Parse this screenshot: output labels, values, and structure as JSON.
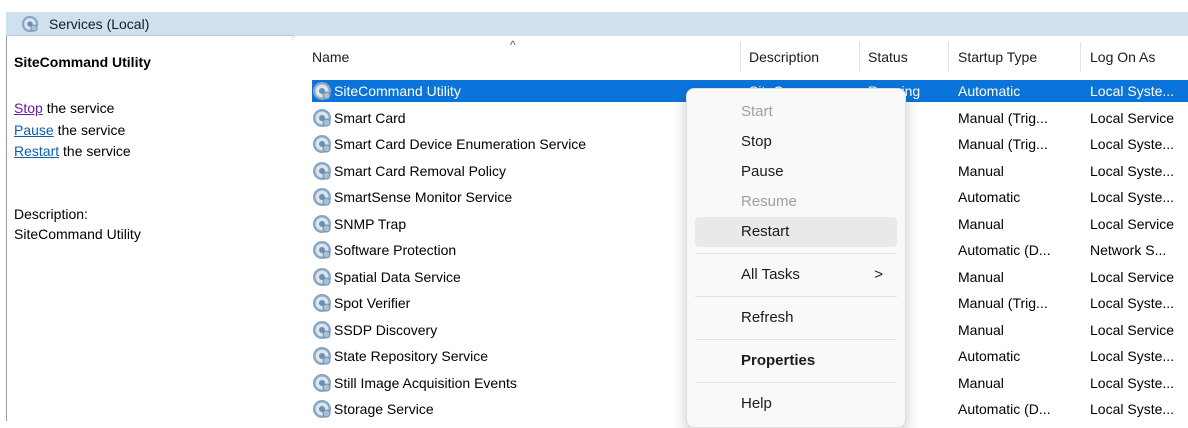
{
  "header": {
    "title": "Services (Local)",
    "icon": "services-gear-icon"
  },
  "left_panel": {
    "title": "SiteCommand Utility",
    "links": [
      {
        "link": "Stop",
        "rest": " the service"
      },
      {
        "link": "Pause",
        "rest": " the service"
      },
      {
        "link": "Restart",
        "rest": " the service"
      }
    ],
    "description_label": "Description:",
    "description_value": "SiteCommand Utility"
  },
  "columns": {
    "name": "Name",
    "description": "Description",
    "status": "Status",
    "startup": "Startup Type",
    "logon": "Log On As"
  },
  "sort_indicator": "^",
  "rows": [
    {
      "name": "SiteCommand Utility",
      "description": "SiteC...",
      "status": "Running",
      "startup": "Automatic",
      "logon": "Local Syste...",
      "selected": true
    },
    {
      "name": "Smart Card",
      "description": "",
      "status": "",
      "startup": "Manual (Trig...",
      "logon": "Local Service"
    },
    {
      "name": "Smart Card Device Enumeration Service",
      "description": "",
      "status": "",
      "startup": "Manual (Trig...",
      "logon": "Local Syste..."
    },
    {
      "name": "Smart Card Removal Policy",
      "description": "",
      "status": "",
      "startup": "Manual",
      "logon": "Local Syste..."
    },
    {
      "name": "SmartSense Monitor Service",
      "description": "",
      "status": "ning",
      "startup": "Automatic",
      "logon": "Local Syste..."
    },
    {
      "name": "SNMP Trap",
      "description": "",
      "status": "",
      "startup": "Manual",
      "logon": "Local Service"
    },
    {
      "name": "Software Protection",
      "description": "",
      "status": "",
      "startup": "Automatic (D...",
      "logon": "Network S..."
    },
    {
      "name": "Spatial Data Service",
      "description": "",
      "status": "",
      "startup": "Manual",
      "logon": "Local Service"
    },
    {
      "name": "Spot Verifier",
      "description": "",
      "status": "",
      "startup": "Manual (Trig...",
      "logon": "Local Syste..."
    },
    {
      "name": "SSDP Discovery",
      "description": "",
      "status": "ning",
      "startup": "Manual",
      "logon": "Local Service"
    },
    {
      "name": "State Repository Service",
      "description": "",
      "status": "ning",
      "startup": "Automatic",
      "logon": "Local Syste..."
    },
    {
      "name": "Still Image Acquisition Events",
      "description": "",
      "status": "",
      "startup": "Manual",
      "logon": "Local Syste..."
    },
    {
      "name": "Storage Service",
      "description": "",
      "status": "ning",
      "startup": "Automatic (D...",
      "logon": "Local Syste..."
    }
  ],
  "context_menu": {
    "start": "Start",
    "stop": "Stop",
    "pause": "Pause",
    "resume": "Resume",
    "restart": "Restart",
    "all_tasks": "All Tasks",
    "all_tasks_arrow": ">",
    "refresh": "Refresh",
    "properties": "Properties",
    "help": "Help"
  },
  "colors": {
    "selection": "#0a74da",
    "header": "#cfe0ee",
    "link": "#0b5fb3",
    "visited_link": "#6a1b9a"
  }
}
